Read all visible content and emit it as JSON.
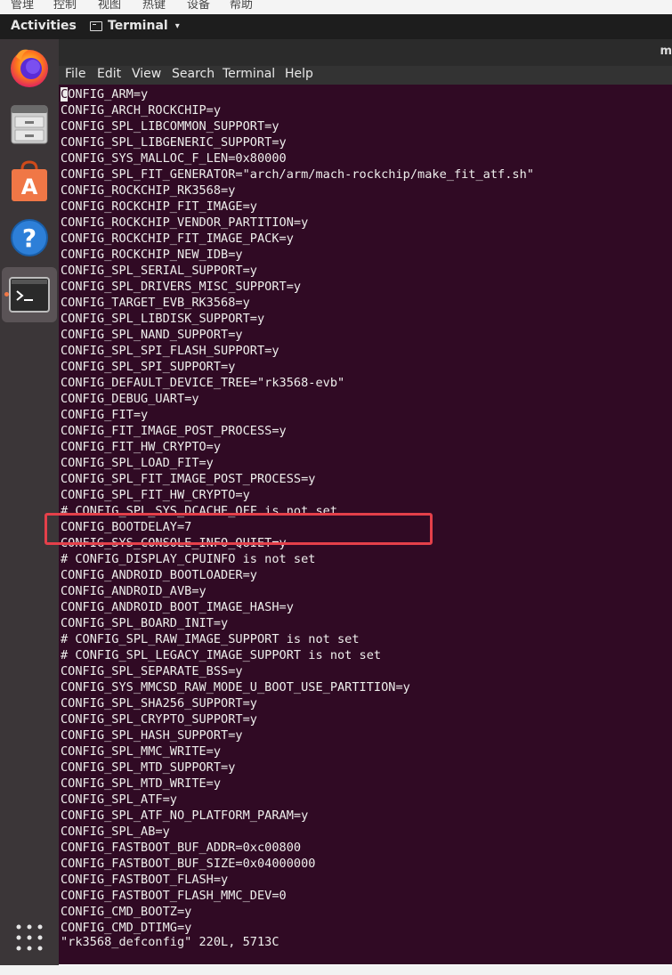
{
  "host_menu": [
    "管理",
    "控制",
    "视图",
    "热键",
    "设备",
    "帮助"
  ],
  "topbar": {
    "activities": "Activities",
    "app_name": "Terminal",
    "app_icon": "terminal-icon",
    "caret": "▾"
  },
  "dock": {
    "items": [
      {
        "name": "firefox",
        "icon": "firefox-icon"
      },
      {
        "name": "files",
        "icon": "file-cabinet-icon"
      },
      {
        "name": "software",
        "icon": "software-store-icon"
      },
      {
        "name": "help",
        "icon": "help-icon"
      },
      {
        "name": "terminal",
        "icon": "terminal-icon",
        "active": true
      }
    ],
    "apps_grid_icon": "apps-grid-icon"
  },
  "terminal": {
    "title_fragment": "m",
    "menu": [
      "File",
      "Edit",
      "View",
      "Search",
      "Terminal",
      "Help"
    ],
    "cursor_char": "C",
    "first_line_rest": "ONFIG_ARM=y",
    "lines": [
      "CONFIG_ARCH_ROCKCHIP=y",
      "CONFIG_SPL_LIBCOMMON_SUPPORT=y",
      "CONFIG_SPL_LIBGENERIC_SUPPORT=y",
      "CONFIG_SYS_MALLOC_F_LEN=0x80000",
      "CONFIG_SPL_FIT_GENERATOR=\"arch/arm/mach-rockchip/make_fit_atf.sh\"",
      "CONFIG_ROCKCHIP_RK3568=y",
      "CONFIG_ROCKCHIP_FIT_IMAGE=y",
      "CONFIG_ROCKCHIP_VENDOR_PARTITION=y",
      "CONFIG_ROCKCHIP_FIT_IMAGE_PACK=y",
      "CONFIG_ROCKCHIP_NEW_IDB=y",
      "CONFIG_SPL_SERIAL_SUPPORT=y",
      "CONFIG_SPL_DRIVERS_MISC_SUPPORT=y",
      "CONFIG_TARGET_EVB_RK3568=y",
      "CONFIG_SPL_LIBDISK_SUPPORT=y",
      "CONFIG_SPL_NAND_SUPPORT=y",
      "CONFIG_SPL_SPI_FLASH_SUPPORT=y",
      "CONFIG_SPL_SPI_SUPPORT=y",
      "CONFIG_DEFAULT_DEVICE_TREE=\"rk3568-evb\"",
      "CONFIG_DEBUG_UART=y",
      "CONFIG_FIT=y",
      "CONFIG_FIT_IMAGE_POST_PROCESS=y",
      "CONFIG_FIT_HW_CRYPTO=y",
      "CONFIG_SPL_LOAD_FIT=y",
      "CONFIG_SPL_FIT_IMAGE_POST_PROCESS=y",
      "CONFIG_SPL_FIT_HW_CRYPTO=y",
      "# CONFIG_SPL_SYS_DCACHE_OFF is not set",
      "CONFIG_BOOTDELAY=7",
      "CONFIG_SYS_CONSOLE_INFO_QUIET=y",
      "# CONFIG_DISPLAY_CPUINFO is not set",
      "CONFIG_ANDROID_BOOTLOADER=y",
      "CONFIG_ANDROID_AVB=y",
      "CONFIG_ANDROID_BOOT_IMAGE_HASH=y",
      "CONFIG_SPL_BOARD_INIT=y",
      "# CONFIG_SPL_RAW_IMAGE_SUPPORT is not set",
      "# CONFIG_SPL_LEGACY_IMAGE_SUPPORT is not set",
      "CONFIG_SPL_SEPARATE_BSS=y",
      "CONFIG_SYS_MMCSD_RAW_MODE_U_BOOT_USE_PARTITION=y",
      "CONFIG_SPL_SHA256_SUPPORT=y",
      "CONFIG_SPL_CRYPTO_SUPPORT=y",
      "CONFIG_SPL_HASH_SUPPORT=y",
      "CONFIG_SPL_MMC_WRITE=y",
      "CONFIG_SPL_MTD_SUPPORT=y",
      "CONFIG_SPL_MTD_WRITE=y",
      "CONFIG_SPL_ATF=y",
      "CONFIG_SPL_ATF_NO_PLATFORM_PARAM=y",
      "CONFIG_SPL_AB=y",
      "CONFIG_FASTBOOT_BUF_ADDR=0xc00800",
      "CONFIG_FASTBOOT_BUF_SIZE=0x04000000",
      "CONFIG_FASTBOOT_FLASH=y",
      "CONFIG_FASTBOOT_FLASH_MMC_DEV=0",
      "CONFIG_CMD_BOOTZ=y",
      "CONFIG_CMD_DTIMG=y"
    ],
    "status_line": "\"rk3568_defconfig\" 220L, 5713C",
    "highlight_color": "#e4404a"
  }
}
